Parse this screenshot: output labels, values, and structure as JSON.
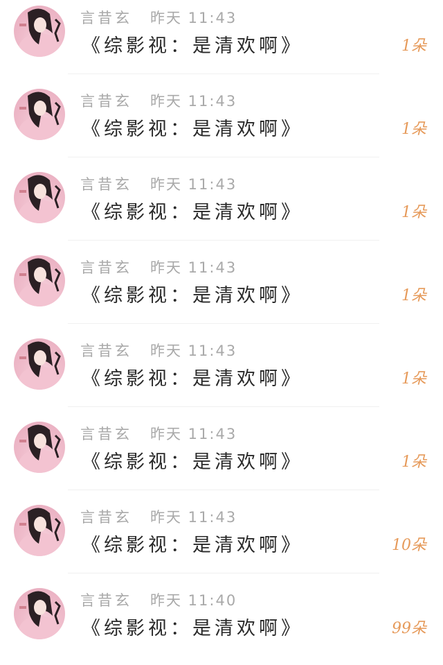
{
  "gifts": [
    {
      "sender": "言昔玄",
      "time": "昨天 11:43",
      "work": "《综影视：是清欢啊》",
      "count": "1朵"
    },
    {
      "sender": "言昔玄",
      "time": "昨天 11:43",
      "work": "《综影视：是清欢啊》",
      "count": "1朵"
    },
    {
      "sender": "言昔玄",
      "time": "昨天 11:43",
      "work": "《综影视：是清欢啊》",
      "count": "1朵"
    },
    {
      "sender": "言昔玄",
      "time": "昨天 11:43",
      "work": "《综影视：是清欢啊》",
      "count": "1朵"
    },
    {
      "sender": "言昔玄",
      "time": "昨天 11:43",
      "work": "《综影视：是清欢啊》",
      "count": "1朵"
    },
    {
      "sender": "言昔玄",
      "time": "昨天 11:43",
      "work": "《综影视：是清欢啊》",
      "count": "1朵"
    },
    {
      "sender": "言昔玄",
      "time": "昨天 11:43",
      "work": "《综影视：是清欢啊》",
      "count": "10朵"
    },
    {
      "sender": "言昔玄",
      "time": "昨天 11:40",
      "work": "《综影视：是清欢啊》",
      "count": "99朵"
    }
  ],
  "colors": {
    "count_accent": "#e69a5a",
    "meta_gray": "#a9a9a9",
    "title_text": "#2a2a2a"
  },
  "icons": {
    "avatar": "avatar-portrait-icon"
  }
}
